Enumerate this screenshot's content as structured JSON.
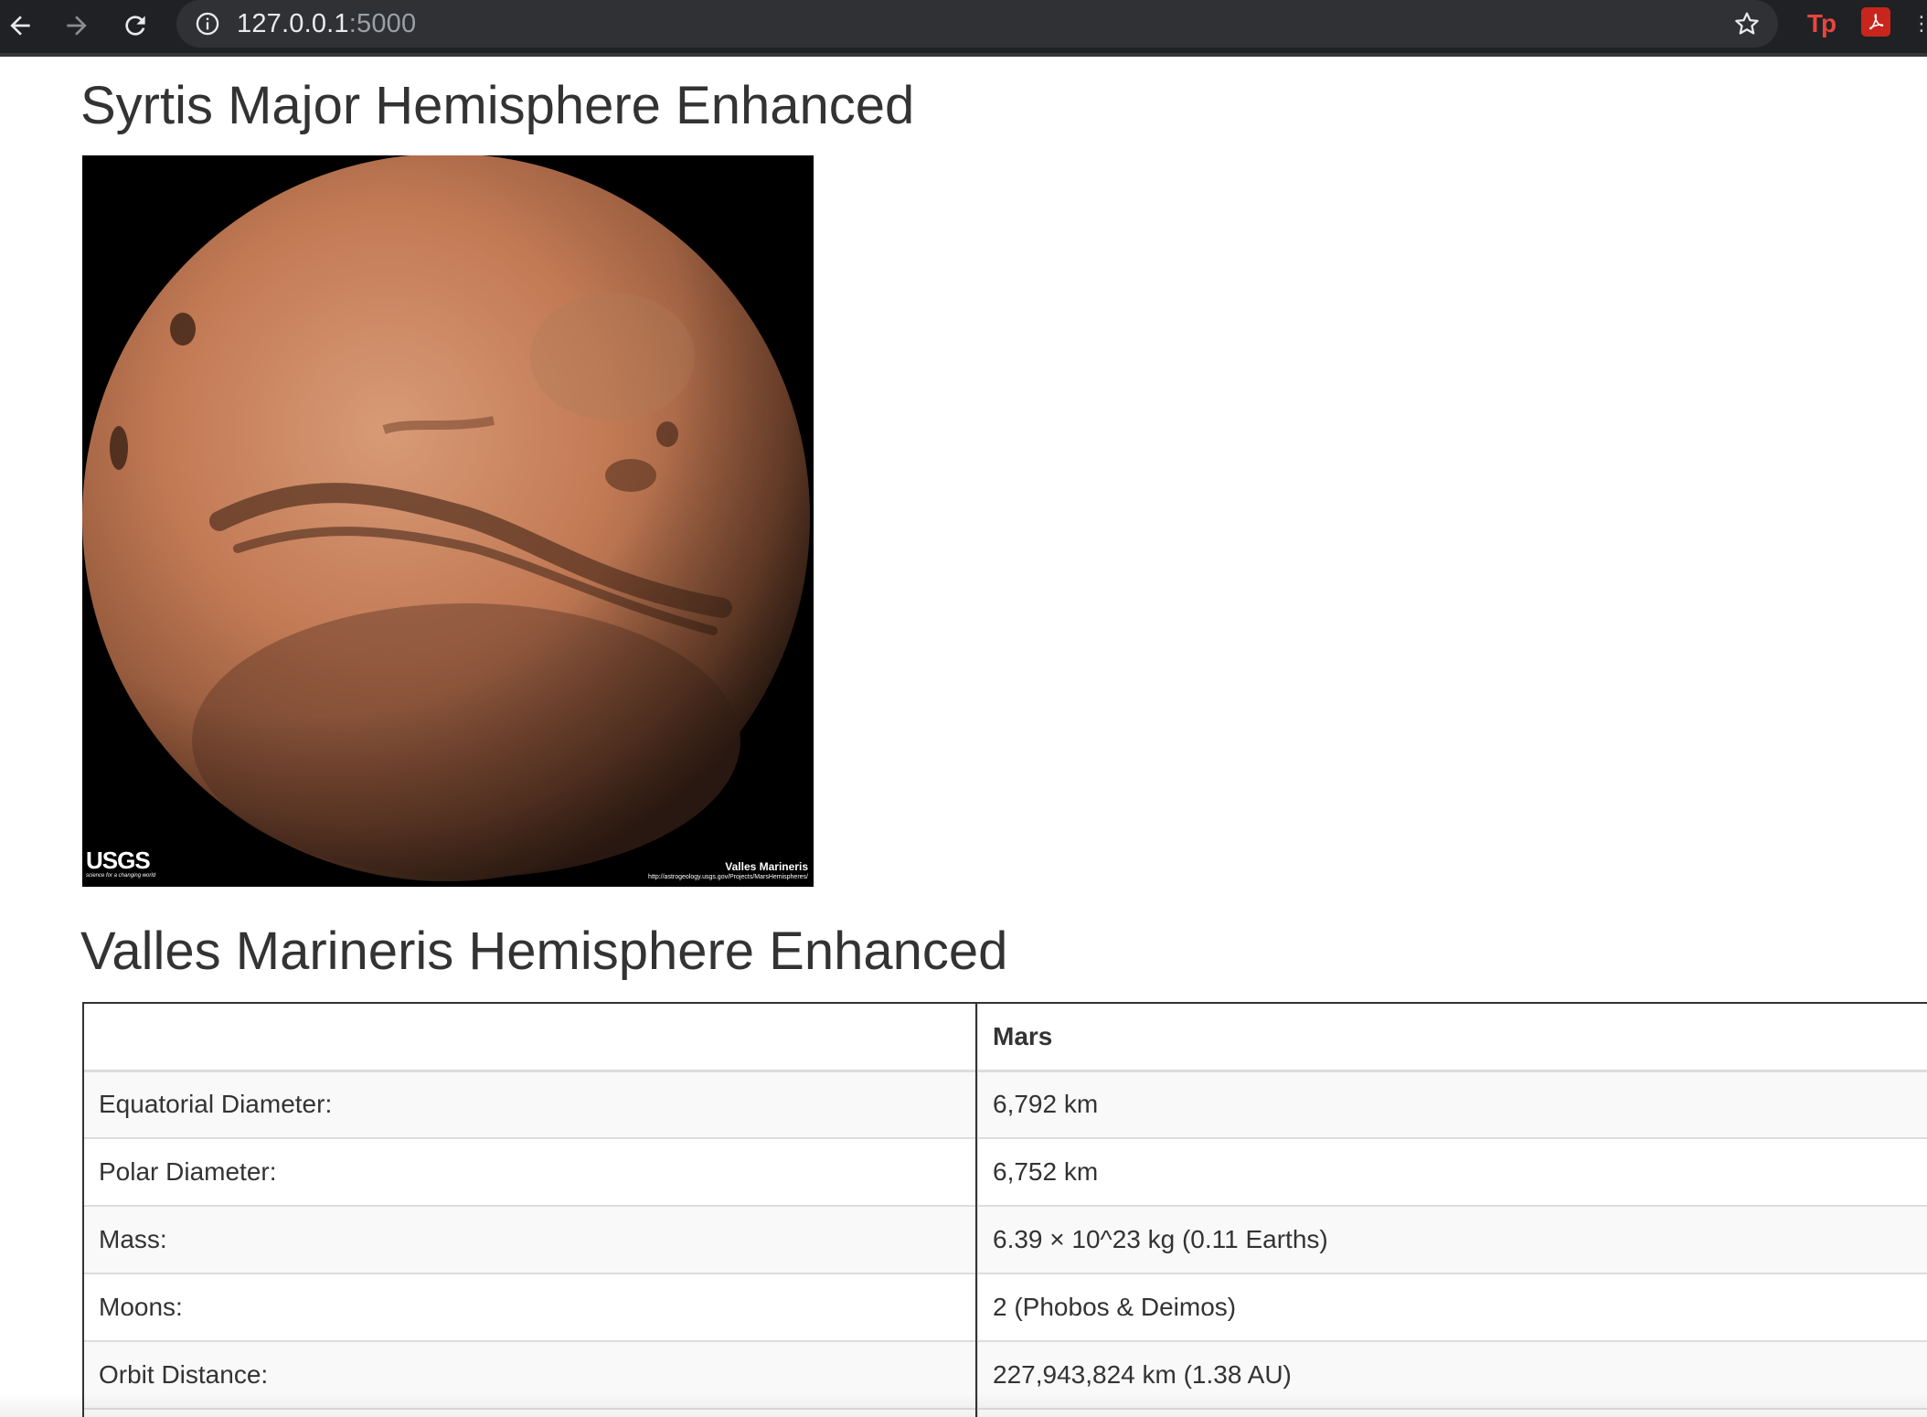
{
  "browser": {
    "url_host": "127.0.0.1",
    "url_port": ":5000"
  },
  "hemispheres": [
    {
      "title": "Syrtis Major Hemisphere Enhanced",
      "image_caption_title": "Valles Marineris",
      "image_caption_url": "http://astrogeology.usgs.gov/Projects/MarsHemispheres/",
      "logo_text": "USGS",
      "logo_tagline": "science for a changing world"
    },
    {
      "title": "Valles Marineris Hemisphere Enhanced"
    }
  ],
  "facts_table": {
    "header": [
      "",
      "Mars"
    ],
    "rows": [
      {
        "label": "Equatorial Diameter:",
        "value": "6,792 km"
      },
      {
        "label": "Polar Diameter:",
        "value": "6,752 km"
      },
      {
        "label": "Mass:",
        "value": "6.39 × 10^23 kg (0.11 Earths)"
      },
      {
        "label": "Moons:",
        "value": "2 (Phobos & Deimos)"
      },
      {
        "label": "Orbit Distance:",
        "value": "227,943,824 km (1.38 AU)"
      },
      {
        "label": "",
        "value": ""
      }
    ]
  },
  "colors": {
    "chrome_bg": "#202124",
    "omnibox_bg": "#303134",
    "text": "#333333",
    "table_border": "#dddddd",
    "mars_surface": "#c27a55"
  }
}
